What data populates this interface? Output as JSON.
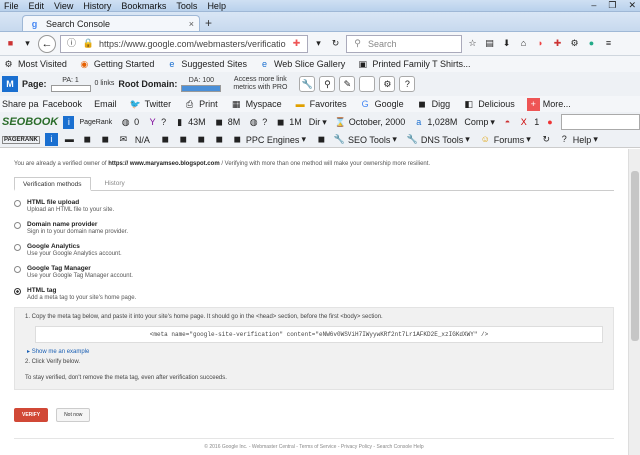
{
  "menubar": {
    "items": [
      "File",
      "Edit",
      "View",
      "History",
      "Bookmarks",
      "Tools",
      "Help"
    ],
    "window_controls": [
      "–",
      "❐",
      "✕"
    ]
  },
  "tab": {
    "title": "Search Console",
    "close": "×",
    "new_tab": "+"
  },
  "nav": {
    "url": "https://www.google.com/webmasters/verification/verificat",
    "search_placeholder": "Search"
  },
  "bookmarks": [
    "Most Visited",
    "Getting Started",
    "Suggested Sites",
    "Web Slice Gallery",
    "Printed Family T Shirts..."
  ],
  "seo_toolbar": {
    "page_label": "Page:",
    "pa": "PA: 1",
    "links": "0 links",
    "root_label": "Root Domain:",
    "da": "DA: 100",
    "access_text": "Access more link metrics with PRO"
  },
  "share": {
    "label": "Share pa",
    "items": [
      "Facebook",
      "Email",
      "Twitter",
      "Print",
      "Myspace",
      "Favorites",
      "Google",
      "Digg",
      "Delicious",
      "More..."
    ]
  },
  "seobook_bar": {
    "logo": "SEOBOOK",
    "pagerank": "PageRank",
    "items": [
      "0",
      "?",
      "43M",
      "8M",
      "?",
      "1M",
      "Dir",
      "October, 2000",
      "1,028M",
      "Comp",
      "1"
    ]
  },
  "tools_bar": {
    "logo": "PAGERANK",
    "items": [
      "N/A",
      "PPC Engines",
      "SEO Tools",
      "DNS Tools",
      "Forums",
      "Help"
    ]
  },
  "main": {
    "owner_prefix": "You are already a verified owner of",
    "owner_site": "https:// www.maryamseo.blogspot.com",
    "owner_suffix": "/  Verifying with more than one method will make your ownership more resilient.",
    "tabs": [
      "Verification methods",
      "History"
    ],
    "methods": [
      {
        "title": "HTML file upload",
        "desc": "Upload an HTML file to your site."
      },
      {
        "title": "Domain name provider",
        "desc": "Sign in to your domain name provider."
      },
      {
        "title": "Google Analytics",
        "desc": "Use your Google Analytics account."
      },
      {
        "title": "Google Tag Manager",
        "desc": "Use your Google Tag Manager account."
      },
      {
        "title": "HTML tag",
        "desc": "Add a meta tag to your site's home page."
      }
    ],
    "step1": "1. Copy the meta tag below, and paste it into your site's home page. It should go in the <head> section, before the first <body> section.",
    "meta_tag": "<meta name=\"google-site-verification\" content=\"eNW6v0WSViH7IWyywKRf2nt7Lr1AFKD2E_xzIGKdXWY\" />",
    "show_example": "Show me an example",
    "step2": "2. Click Verify below.",
    "stay": "To stay verified, don't remove the meta tag, even after verification succeeds.",
    "verify_button": "VERIFY",
    "not_now_button": "Not now"
  },
  "footer": "© 2016 Google Inc. - Webmaster Central - Terms of Service - Privacy Policy - Search Console Help"
}
